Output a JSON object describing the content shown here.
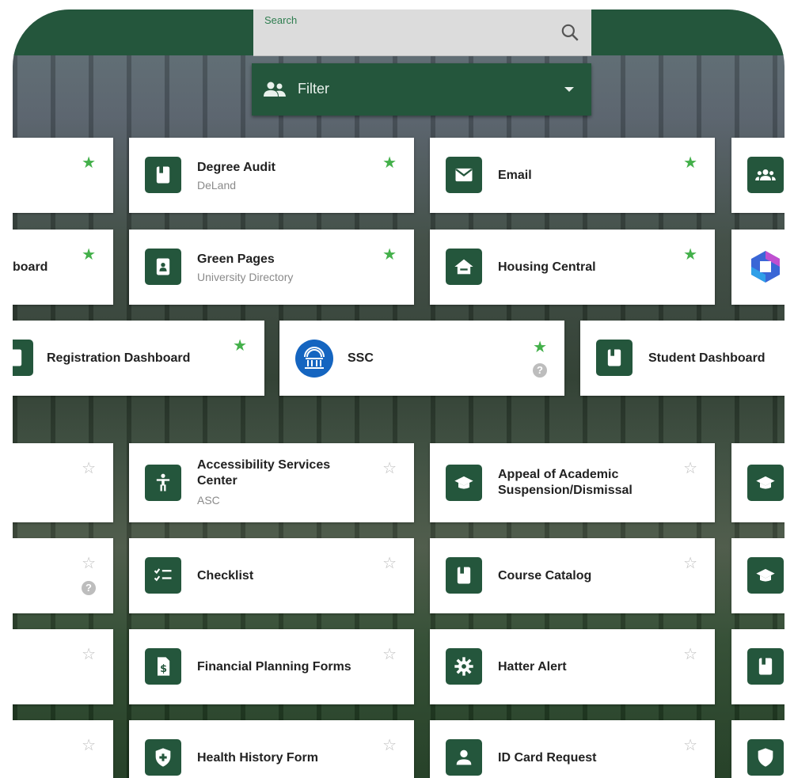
{
  "search": {
    "label": "Search"
  },
  "filter": {
    "label": "Filter"
  },
  "apps": [
    {
      "title": "",
      "subtitle": "",
      "star": "on"
    },
    {
      "title": "Degree Audit",
      "subtitle": "DeLand",
      "star": "on"
    },
    {
      "title": "Email",
      "subtitle": "",
      "star": "on"
    },
    {
      "title": "",
      "subtitle": "",
      "star": ""
    },
    {
      "title": "board",
      "subtitle": "",
      "star": "on"
    },
    {
      "title": "Green Pages",
      "subtitle": "University Directory",
      "star": "on"
    },
    {
      "title": "Housing Central",
      "subtitle": "",
      "star": "on"
    },
    {
      "title": "",
      "subtitle": "",
      "star": ""
    },
    {
      "title": "Registration Dashboard",
      "subtitle": "",
      "star": "on"
    },
    {
      "title": "SSC",
      "subtitle": "",
      "star": "on",
      "help": "?"
    },
    {
      "title": "Student Dashboard",
      "subtitle": "",
      "star": ""
    },
    {
      "title": "",
      "subtitle": "",
      "star": "off"
    },
    {
      "title": "Accessibility Services Center",
      "subtitle": "ASC",
      "star": "off"
    },
    {
      "title": "Appeal of Academic Suspension/Dismissal",
      "subtitle": "",
      "star": "off"
    },
    {
      "title": "",
      "subtitle": "",
      "star": ""
    },
    {
      "title": "",
      "subtitle": "",
      "star": "off",
      "help": "?"
    },
    {
      "title": "Checklist",
      "subtitle": "",
      "star": "off"
    },
    {
      "title": "Course Catalog",
      "subtitle": "",
      "star": "off"
    },
    {
      "title": "",
      "subtitle": "",
      "star": ""
    },
    {
      "title": "",
      "subtitle": "",
      "star": "off"
    },
    {
      "title": "Financial Planning Forms",
      "subtitle": "",
      "star": "off"
    },
    {
      "title": "Hatter Alert",
      "subtitle": "",
      "star": "off"
    },
    {
      "title": "",
      "subtitle": "",
      "star": ""
    },
    {
      "title": "",
      "subtitle": "",
      "star": "off"
    },
    {
      "title": "Health History Form",
      "subtitle": "",
      "star": "off"
    },
    {
      "title": "ID Card Request",
      "subtitle": "",
      "star": "off"
    },
    {
      "title": "",
      "subtitle": "",
      "star": ""
    }
  ],
  "icons": {
    "book": "book-icon",
    "mail": "mail-icon",
    "group": "group-icon",
    "contact": "contact-icon",
    "house": "house-icon",
    "m365": "microsoft-365-icon",
    "ssc": "institution-icon",
    "person": "accessibility-person-icon",
    "cap": "graduation-cap-icon",
    "checklist": "checklist-icon",
    "doc": "dollar-document-icon",
    "gear": "gear-icon",
    "shield": "shield-plus-icon",
    "id": "id-person-icon"
  },
  "colors": {
    "brand_green": "#24563c",
    "star_on": "#43b04a",
    "star_off": "#bdbdbd",
    "ssc_blue": "#1565c0"
  }
}
